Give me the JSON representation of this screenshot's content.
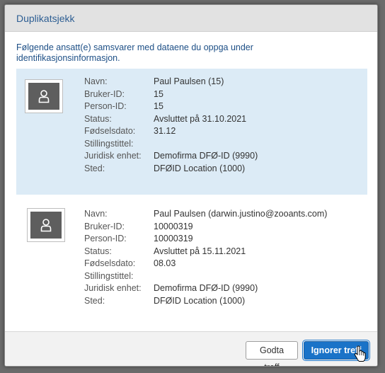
{
  "dialog": {
    "title": "Duplikatsjekk",
    "intro": "Følgende ansatt(e) samsvarer med dataene du oppga under identifikasjonsinformasjon."
  },
  "labels": {
    "name": "Navn:",
    "user_id": "Bruker-ID:",
    "person_id": "Person-ID:",
    "status": "Status:",
    "birth_date": "Fødselsdato:",
    "job_title": "Stillingstittel:",
    "legal_entity": "Juridisk enhet:",
    "location": "Sted:"
  },
  "records": [
    {
      "name": "Paul Paulsen (15)",
      "user_id": "15",
      "person_id": "15",
      "status": "Avsluttet på 31.10.2021",
      "birth_date": "31.12",
      "job_title": "",
      "legal_entity": "Demofirma DFØ-ID (9990)",
      "location": "DFØID Location (1000)"
    },
    {
      "name": "Paul Paulsen (darwin.justino@zooants.com)",
      "user_id": "10000319",
      "person_id": "10000319",
      "status": "Avsluttet på 15.11.2021",
      "birth_date": "08.03",
      "job_title": "",
      "legal_entity": "Demofirma DFØ-ID (9990)",
      "location": "DFØID Location (1000)"
    }
  ],
  "footer": {
    "accept_label": "Godta treff",
    "ignore_label": "Ignorer treff"
  },
  "icons": {
    "avatar": "person-icon",
    "cursor": "hand-pointer-icon"
  },
  "colors": {
    "title": "#2d5e93",
    "selected_row": "#dcebf6",
    "primary_button": "#1a73c8"
  }
}
